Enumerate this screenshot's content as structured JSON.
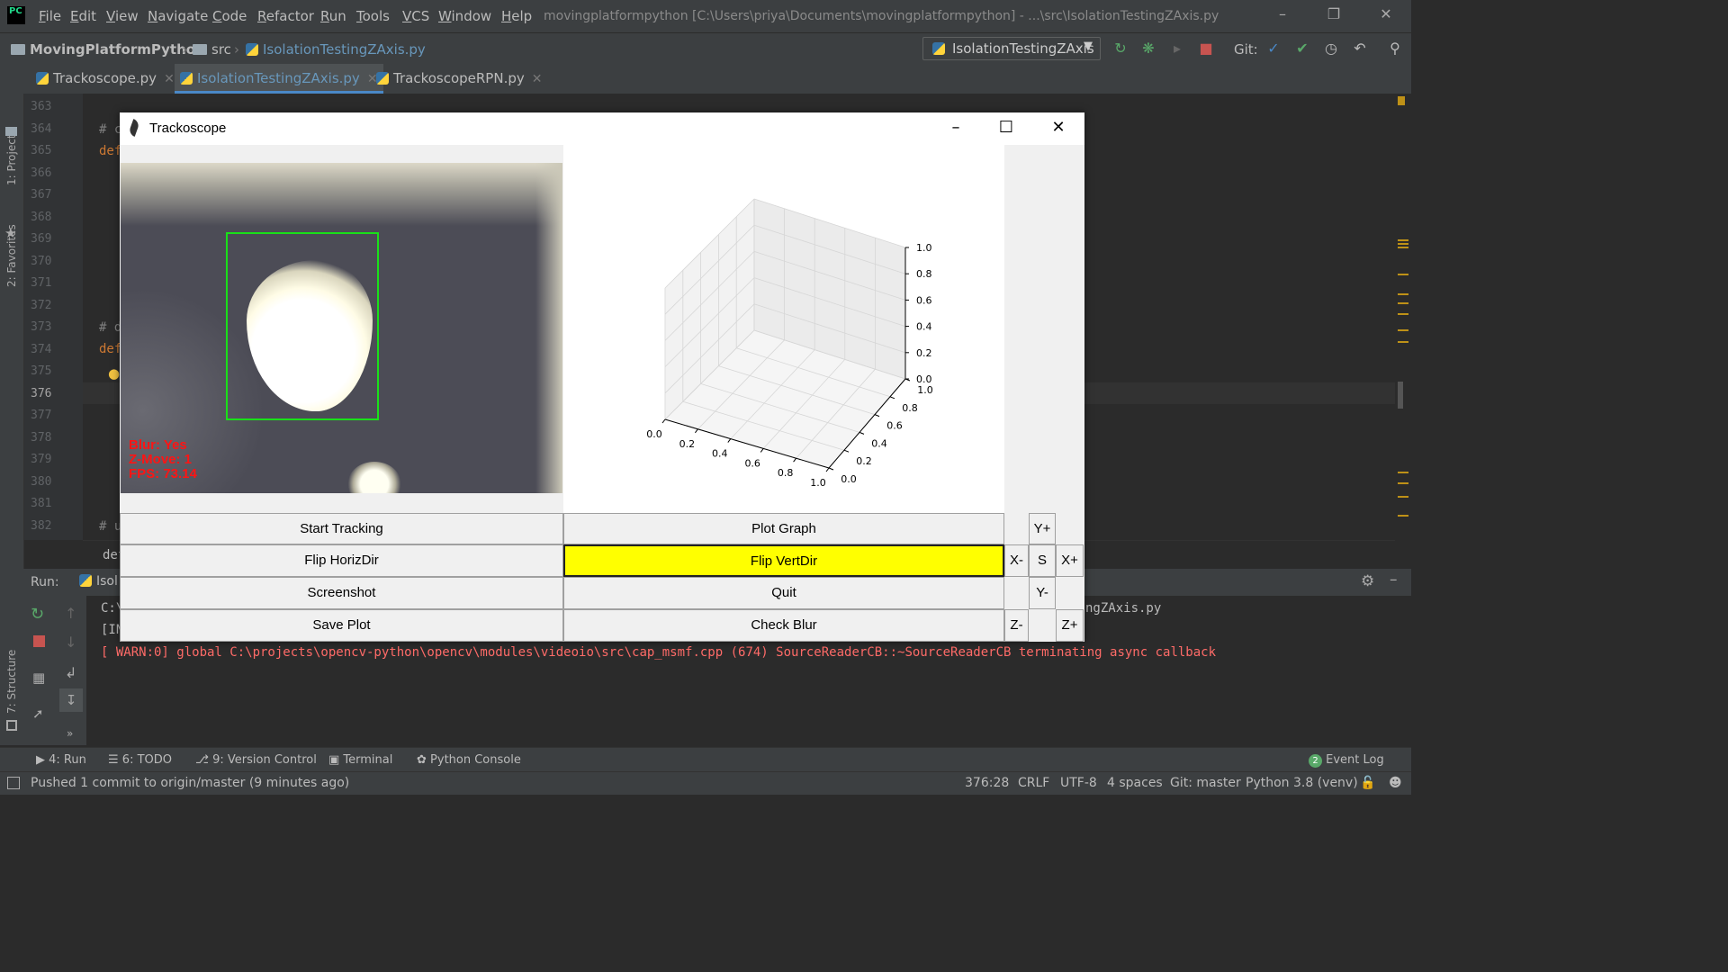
{
  "ide": {
    "menu": [
      "File",
      "Edit",
      "View",
      "Navigate",
      "Code",
      "Refactor",
      "Run",
      "Tools",
      "VCS",
      "Window",
      "Help"
    ],
    "window_title": "movingplatformpython [C:\\Users\\priya\\Documents\\movingplatformpython] - ...\\src\\IsolationTestingZAxis.py",
    "breadcrumb": {
      "project": "MovingPlatformPython",
      "folder": "src",
      "file": "IsolationTestingZAxis.py"
    },
    "run_config": "IsolationTestingZAxis",
    "git_label": "Git:",
    "tabs": [
      {
        "label": "Trackoscope.py",
        "active": false
      },
      {
        "label": "IsolationTestingZAxis.py",
        "active": true
      },
      {
        "label": "TrackoscopeRPN.py",
        "active": false
      }
    ],
    "side_tools": {
      "project": "1: Project",
      "favorites": "2: Favorites",
      "structure": "7: Structure"
    },
    "line_numbers": [
      "363",
      "364",
      "365",
      "366",
      "367",
      "368",
      "369",
      "370",
      "371",
      "372",
      "373",
      "374",
      "375",
      "376",
      "377",
      "378",
      "379",
      "380",
      "381",
      "382"
    ],
    "current_line": "376",
    "code_fragments": {
      "l364": "# c",
      "l365": "def",
      "l373": "# d",
      "l374": "def",
      "l382": "# u",
      "crumb": "def"
    },
    "run_panel": {
      "title": "Run:",
      "tab": "Isol",
      "lines": [
        "C:\\",
        "[IN",
        "[ WARN:0] global C:\\projects\\opencv-python\\opencv\\modules\\videoio\\src\\cap_msmf.cpp (674) SourceReaderCB::~SourceReaderCB terminating async callback"
      ],
      "right_text": "ngZAxis.py"
    },
    "bottom_tools": [
      "4: Run",
      "6: TODO",
      "9: Version Control",
      "Terminal",
      "Python Console"
    ],
    "event_log": {
      "count": "2",
      "label": "Event Log"
    },
    "status": {
      "message": "Pushed 1 commit to origin/master (9 minutes ago)",
      "position": "376:28",
      "line_sep": "CRLF",
      "encoding": "UTF-8",
      "indent": "4 spaces",
      "git": "Git: master",
      "interpreter": "Python 3.8 (venv)"
    }
  },
  "trackoscope": {
    "title": "Trackoscope",
    "camera_overlay": [
      "Blur: Yes",
      "Z-Move: 1",
      "FPS: 73.14"
    ],
    "buttons": {
      "start_tracking": "Start Tracking",
      "plot_graph": "Plot Graph",
      "flip_horiz": "Flip HorizDir",
      "flip_vert": "Flip VertDir",
      "screenshot": "Screenshot",
      "quit": "Quit",
      "save_plot": "Save Plot",
      "check_blur": "Check Blur"
    },
    "direction": {
      "y_plus": "Y+",
      "x_minus": "X-",
      "stop": "S",
      "x_plus": "X+",
      "y_minus": "Y-",
      "z_minus": "Z-",
      "z_plus": "Z+"
    },
    "highlight_color": "#ffff00"
  },
  "chart_data": {
    "type": "scatter",
    "projection": "3d",
    "title": "",
    "x_ticks": [
      "0.0",
      "0.2",
      "0.4",
      "0.6",
      "0.8",
      "1.0"
    ],
    "y_ticks": [
      "0.0",
      "0.2",
      "0.4",
      "0.6",
      "0.8",
      "1.0"
    ],
    "z_ticks": [
      "0.0",
      "0.2",
      "0.4",
      "0.6",
      "0.8",
      "1.0"
    ],
    "xlim": [
      0,
      1
    ],
    "ylim": [
      0,
      1
    ],
    "zlim": [
      0,
      1
    ],
    "series": [],
    "grid": true
  }
}
